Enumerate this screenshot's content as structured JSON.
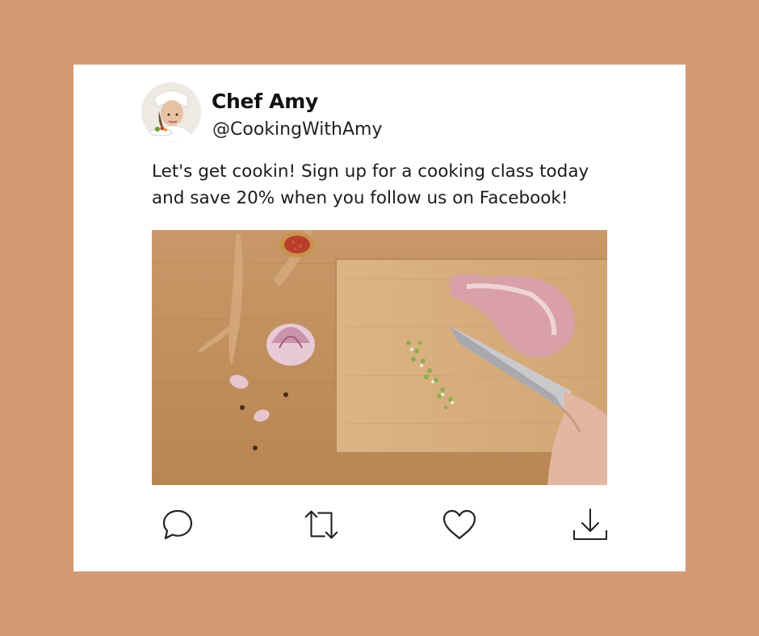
{
  "post": {
    "author_name": "Chef Amy",
    "author_handle": "@CookingWithAmy",
    "text_lines": [
      "Let's get cookin! Sign up for a cooking class today",
      "and save 20% when you follow us on Facebook!"
    ]
  },
  "actions": {
    "icons": [
      "comment-icon",
      "retweet-icon",
      "heart-icon",
      "download-icon"
    ]
  },
  "colors": {
    "background": "#D49A75",
    "card": "#FFFFFF",
    "text": "#1A1A1A"
  }
}
